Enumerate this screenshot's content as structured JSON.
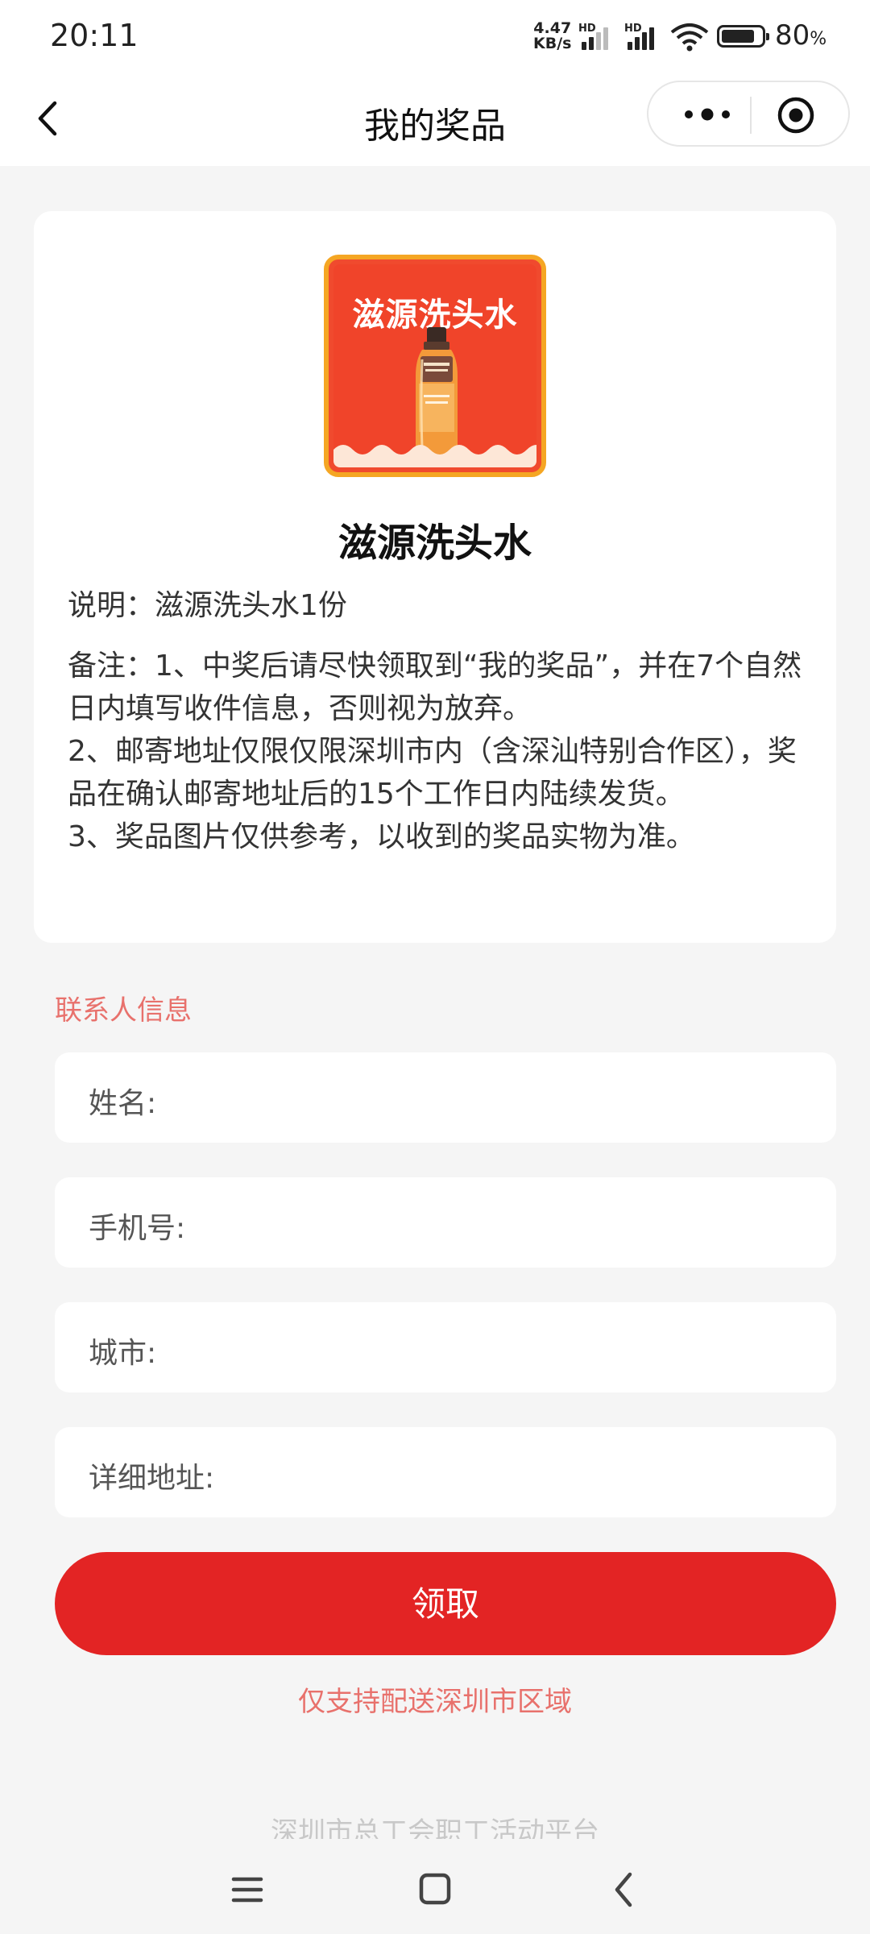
{
  "status_bar": {
    "time": "20:11",
    "net_speed_value": "4.47",
    "net_speed_unit": "KB/s",
    "hd_label_1": "HD",
    "hd_label_2": "HD",
    "battery_percent": "80",
    "battery_unit": "%"
  },
  "nav": {
    "title": "我的奖品"
  },
  "prize": {
    "image_title": "滋源洗头水",
    "name": "滋源洗头水",
    "description": "说明：滋源洗头水1份",
    "remarks": [
      "备注：1、中奖后请尽快领取到“我的奖品”，并在7个自然日内填写收件信息，否则视为放弃。",
      "2、邮寄地址仅限仅限深圳市内（含深汕特别合作区），奖品在确认邮寄地址后的15个工作日内陆续发货。",
      "3、奖品图片仅供参考，以收到的奖品实物为准。"
    ]
  },
  "contact": {
    "section_title": "联系人信息",
    "fields": [
      {
        "label": "姓名:",
        "value": ""
      },
      {
        "label": "手机号:",
        "value": ""
      },
      {
        "label": "城市:",
        "value": ""
      },
      {
        "label": "详细地址:",
        "value": ""
      }
    ]
  },
  "submit_label": "领取",
  "notice": "仅支持配送深圳市区域",
  "footer": "深圳市总工会职工活动平台",
  "colors": {
    "primary_red": "#e32424",
    "hint_pink": "#e8716c",
    "badge_orange": "#f5a623"
  }
}
